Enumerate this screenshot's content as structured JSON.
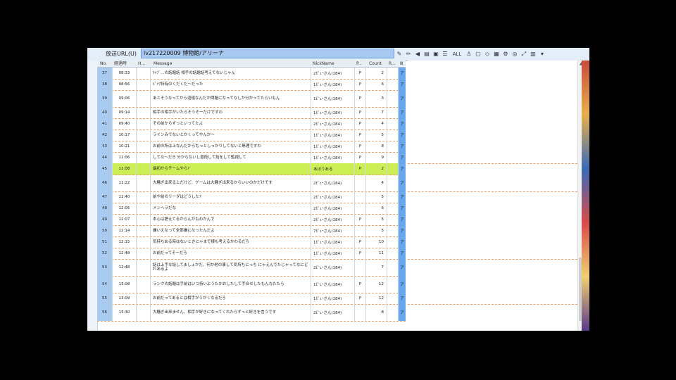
{
  "topbar": {
    "url_label": "放送URL(U)",
    "url_value": "lv217220009 博物館/アリーナ"
  },
  "toolbar": {
    "icons": [
      "pen-icon",
      "pencil-icon",
      "speaker-icon",
      "document-icon",
      "stamp-icon",
      "list-icon"
    ],
    "all_label": "ALL"
  },
  "columns": [
    "No.",
    "経過時",
    "H...",
    "Message",
    "NickName",
    "P...",
    "Count",
    "R...",
    "Ⅲ"
  ],
  "rows": [
    {
      "no": "37",
      "time": "08:33",
      "msg": "ﾁｬﾌﾞ…の話題話 相手の話題話考えてないじゃん",
      "nick": "2ﾋﾟｭｰさん(184)",
      "p": "P",
      "count": "2",
      "f": "ア"
    },
    {
      "no": "38",
      "time": "08:56",
      "msg": "ﾋﾟｬﾂ特有のくだくだ〜だった",
      "nick": "1ﾋﾟｭｰさん(184)",
      "p": "P",
      "count": "6",
      "f": "ア"
    },
    {
      "no": "39",
      "time": "09:06",
      "msg": "あとそうなってから道徳なんだか問題になってなしか分かってたらいもん",
      "nick": "1ﾋﾟｭｰさん(184)",
      "p": "P",
      "count": "3",
      "f": "ア"
    },
    {
      "no": "40",
      "time": "09:14",
      "msg": "相手の相手がいたらそうそーだけですわ",
      "nick": "1ﾋﾟｭｰさん(184)",
      "p": "P",
      "count": "7",
      "f": "ア"
    },
    {
      "no": "41",
      "time": "09:40",
      "msg": "その前からずっといってたよ",
      "nick": "2ﾋﾟｭｰさん(184)",
      "p": "P",
      "count": "4",
      "f": "ア"
    },
    {
      "no": "42",
      "time": "10:17",
      "msg": "ラインみてないとかくってやんか〜",
      "nick": "1ﾋﾟｭｰさん(184)",
      "p": "P",
      "count": "5",
      "f": "ア"
    },
    {
      "no": "43",
      "time": "10:21",
      "msg": "お前の所は上なんだからもっとしっかりしてないと無理ですわ",
      "nick": "1ﾋﾟｭｰさん(184)",
      "p": "P",
      "count": "8",
      "f": "ア"
    },
    {
      "no": "44",
      "time": "11:06",
      "msg": "してな〜だろ 分からないし普段して話をして監視して",
      "nick": "1ﾋﾟｭｰさん(184)",
      "p": "P",
      "count": "9",
      "f": "ア"
    },
    {
      "no": "45",
      "time": "11:08",
      "msg": "最初からチームやら?",
      "nick": "あぼうある",
      "p": "P",
      "count": "2",
      "f": "ア",
      "hl": true
    },
    {
      "no": "46",
      "time": "11:22",
      "msg": "大騒ぎ出来る上だけど、ゲームは大騒ぎ出来るからいいのかだけです",
      "nick": "2ﾋﾟｭｰさん(184)",
      "p": "",
      "count": "4",
      "f": "ア"
    },
    {
      "no": "47",
      "time": "11:40",
      "msg": "前や前のリーダはどうした?",
      "nick": "2ﾋﾟｭｰさん(184)",
      "p": "",
      "count": "5",
      "f": "ア"
    },
    {
      "no": "48",
      "time": "12:05",
      "msg": "メンヘラだな",
      "nick": "2ﾋﾟｭｰさん(184)",
      "p": "",
      "count": "6",
      "f": "ア"
    },
    {
      "no": "49",
      "time": "12:07",
      "msg": "本心は肥えてるからんかもわかんで",
      "nick": "2ﾋﾟｭｰさん(184)",
      "p": "P",
      "count": "5",
      "f": "ア"
    },
    {
      "no": "50",
      "time": "12:14",
      "msg": "嫌いえなって全部嫌になったんだよ",
      "nick": "7ﾋﾟｭｰさん(184)",
      "p": "",
      "count": "5",
      "f": "ア"
    },
    {
      "no": "51",
      "time": "12:15",
      "msg": "気持ちある時はないときにゃまで様も考えるかわるだろ",
      "nick": "1ﾋﾟｭｰさん(184)",
      "p": "P",
      "count": "10",
      "f": "ア"
    },
    {
      "no": "52",
      "time": "12:48",
      "msg": "お前だってそーだろ",
      "nick": "1ﾋﾟｭｰさん(184)",
      "p": "P",
      "count": "11",
      "f": "ア"
    },
    {
      "no": "53",
      "time": "12:48",
      "msg": "話は上手な話してましょかだ、何か他の事して気持ちにっち にゃえんでたじゃってなにどれあるよ",
      "nick": "2ﾋﾟｭｰさん(184)",
      "p": "",
      "count": "7",
      "f": "ア"
    },
    {
      "no": "54",
      "time": "13:08",
      "msg": "ランクの話題は手前はいつ持いようたかおしたして手合せしたもんなたたら",
      "nick": "1ﾋﾟｭｰさん(184)",
      "p": "P",
      "count": "12",
      "f": "ア"
    },
    {
      "no": "55",
      "time": "13:09",
      "msg": "お前だってあるとは相手がうがくなるだろ",
      "nick": "1ﾋﾟｭｰさん(184)",
      "p": "P",
      "count": "12",
      "f": "ア"
    },
    {
      "no": "56",
      "time": "13:30",
      "msg": "大騒ぎ出来ません、相手が好きになってくれたらずっと好きを言うです",
      "nick": "2ﾋﾟｭｰさん(184)",
      "p": "",
      "count": "8",
      "f": "ア"
    }
  ]
}
